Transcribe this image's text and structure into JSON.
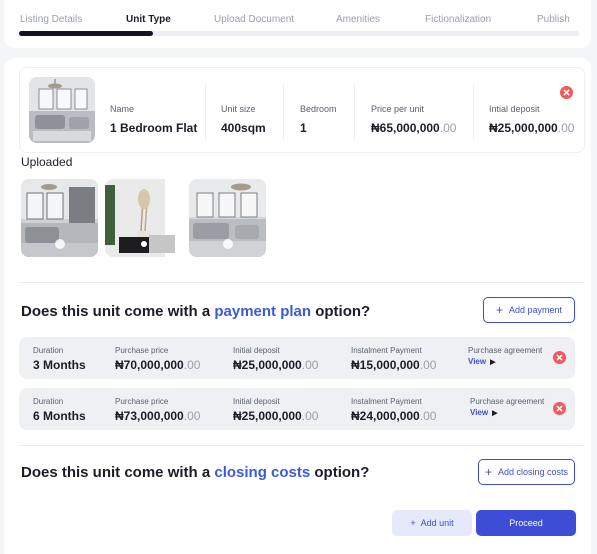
{
  "stepper": {
    "steps": [
      "Listing Details",
      "Unit Type",
      "Upload Document",
      "Amenities",
      "Fictionalization",
      "Publish"
    ],
    "active_index": 1,
    "progress_fraction": 0.24
  },
  "unit": {
    "name_label": "Name",
    "name_value": "1 Bedroom Flat",
    "size_label": "Unit size",
    "size_value": "400sqm",
    "bedroom_label": "Bedroom",
    "bedroom_value": "1",
    "price_label": "Price per unit",
    "price_main": "₦65,000,000",
    "price_dec": ".00",
    "deposit_label": "Intial deposit",
    "deposit_main": "₦25,000,000",
    "deposit_dec": ".00"
  },
  "uploaded": {
    "title": "Uploaded"
  },
  "payment_plan": {
    "question_prefix": "Does this unit come with a ",
    "question_highlight": "payment plan",
    "question_suffix": " option?",
    "add_button": "Add payment",
    "labels": {
      "duration": "Duration",
      "purchase_price": "Purchase price",
      "initial_deposit": "Initial deposit",
      "instalment": "Instalment Payment",
      "agreement": "Purchase agreement",
      "view": "View"
    },
    "rows": [
      {
        "duration": "3 Months",
        "purchase_main": "₦70,000,000",
        "purchase_dec": ".00",
        "deposit_main": "₦25,000,000",
        "deposit_dec": ".00",
        "instalment_main": "₦15,000,000",
        "instalment_dec": ".00"
      },
      {
        "duration": "6 Months",
        "purchase_main": "₦73,000,000",
        "purchase_dec": ".00",
        "deposit_main": "₦25,000,000",
        "deposit_dec": ".00",
        "instalment_main": "₦24,000,000",
        "instalment_dec": ".00"
      }
    ]
  },
  "closing_costs": {
    "question_prefix": "Does this unit come with a ",
    "question_highlight": "closing costs",
    "question_suffix": " option?",
    "add_button": "Add closing costs"
  },
  "footer": {
    "add_unit": "Add unit",
    "proceed": "Proceed"
  },
  "colors": {
    "accent": "#3d4dd6",
    "danger": "#ef5a5a",
    "dark": "#151520"
  }
}
